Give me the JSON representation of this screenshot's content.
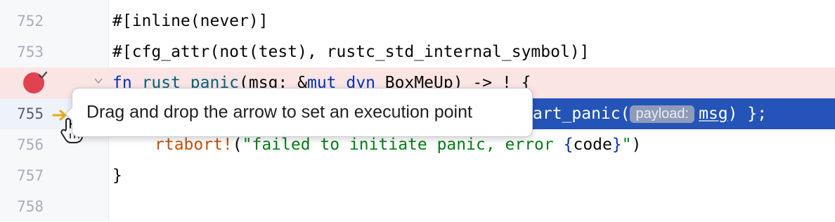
{
  "lines": [
    {
      "number": "752",
      "parts": [
        "#[inline(never)]"
      ]
    },
    {
      "number": "753",
      "parts": [
        "#[cfg_attr(not(test), rustc_std_internal_symbol)]"
      ]
    },
    {
      "number": "",
      "parts": [
        "fn",
        " ",
        "rust_panic",
        "(msg: &",
        "mut",
        " ",
        "dyn",
        " BoxMeUp) -> ! {"
      ]
    },
    {
      "number": "755",
      "parts": [
        "art_panic(",
        "payload:",
        "msg",
        ") };"
      ]
    },
    {
      "number": "756",
      "parts": [
        "rtabort!",
        "(",
        "\"failed to initiate panic, error ",
        "{",
        "code",
        "}",
        "\"",
        ")"
      ]
    },
    {
      "number": "757",
      "parts": [
        "}"
      ]
    },
    {
      "number": "758",
      "parts": []
    }
  ],
  "tooltip": {
    "text": "Drag and drop the arrow to set an execution point"
  },
  "icons": {
    "breakpoint": "breakpoint-icon",
    "verified": "checkmark-icon",
    "fold": "chevron-down-icon",
    "execution": "execution-arrow-icon",
    "cursor": "hand-cursor-icon"
  },
  "colors": {
    "breakpoint_line": "#fbe4e4",
    "execution_line": "#2454b8",
    "breakpoint": "#e0424f",
    "execution_arrow": "#e6a817"
  }
}
